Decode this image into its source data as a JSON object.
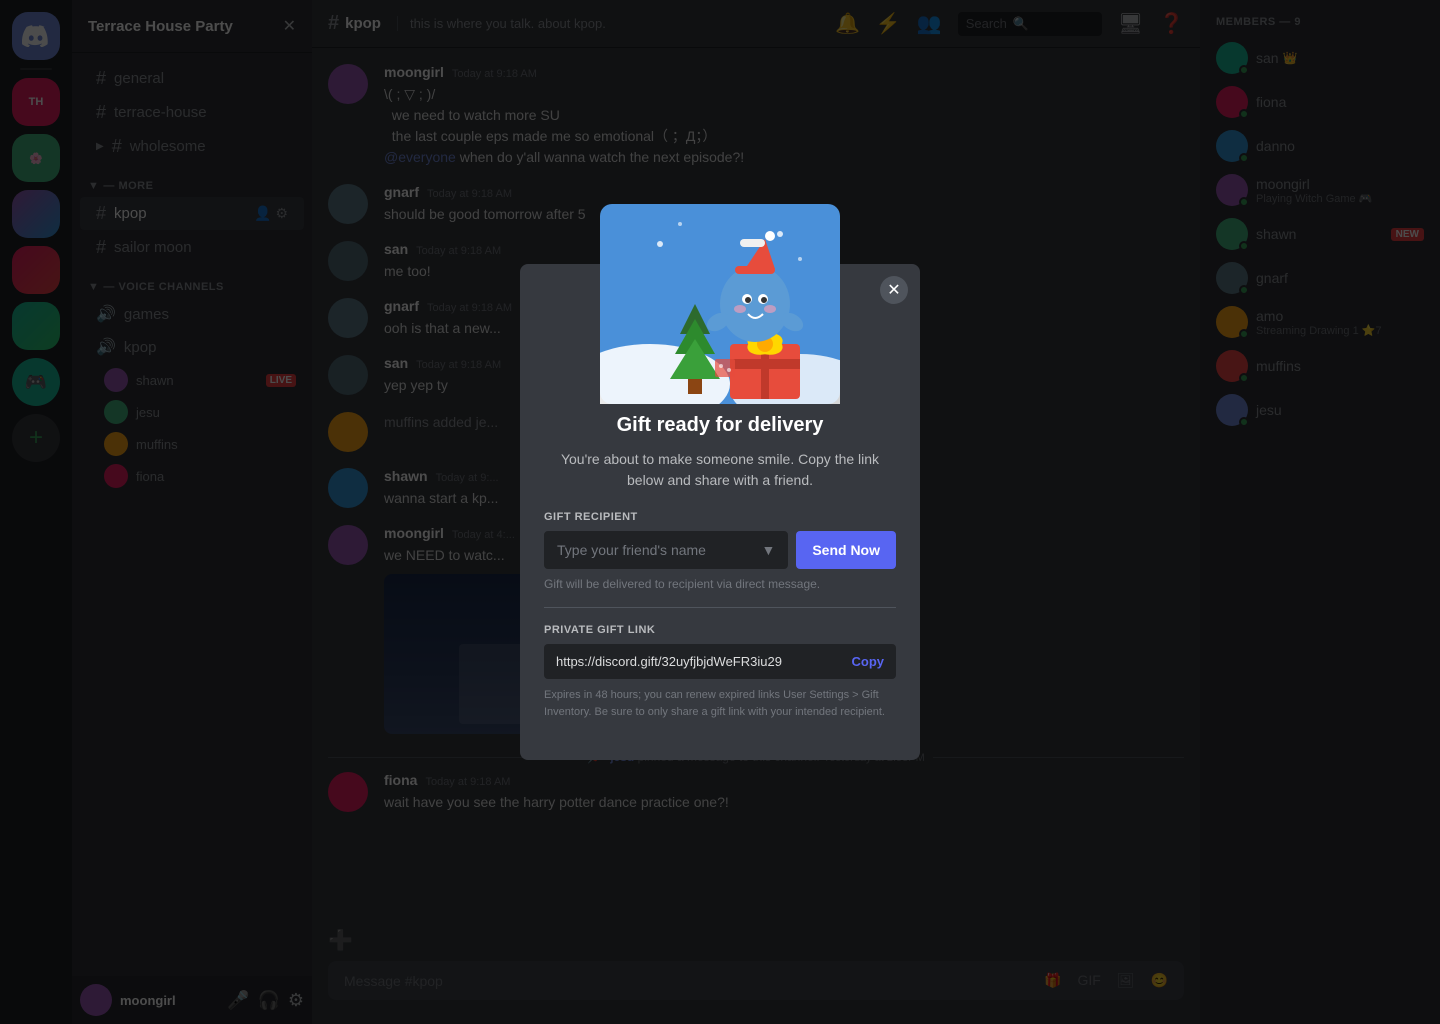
{
  "app": {
    "title": "Discord"
  },
  "server": {
    "name": "Terrace House Party",
    "dropdown_icon": "▼"
  },
  "channels": {
    "text_header": "— MORE",
    "text_channels": [
      {
        "name": "general",
        "type": "text"
      },
      {
        "name": "terrace-house",
        "type": "text"
      },
      {
        "name": "wholesome",
        "type": "text",
        "has_arrow": true
      }
    ],
    "more_channels": [
      {
        "name": "kpop",
        "type": "text",
        "active": true,
        "icons": true
      },
      {
        "name": "sailor moon",
        "type": "text"
      }
    ],
    "voice_header": "— VOICE CHANNELS",
    "voice_channels": [
      {
        "name": "games",
        "type": "voice"
      },
      {
        "name": "kpop",
        "type": "voice",
        "users": [
          {
            "name": "shawn",
            "live": true
          },
          {
            "name": "jesu",
            "live": false
          },
          {
            "name": "muffins",
            "live": false
          },
          {
            "name": "fiona",
            "live": false
          }
        ]
      }
    ]
  },
  "current_channel": {
    "name": "kpop",
    "description": "this is where you talk. about kpop."
  },
  "user_panel": {
    "name": "moongirl",
    "mic_icon": "🎤",
    "headphone_icon": "🎧",
    "settings_icon": "⚙"
  },
  "header": {
    "search_placeholder": "Search",
    "icons": [
      "🔔",
      "⚡",
      "👥",
      "🖥",
      "❓"
    ]
  },
  "messages": [
    {
      "id": 1,
      "author": "moongirl",
      "time": "Today at 9:18 AM",
      "lines": [
        "\\(;▽;)/",
        "we need to watch more SU",
        "the last couple eps made me so emotional（ ；Д；）",
        "@everyone when do y'all wanna watch the next episode?!"
      ],
      "has_mention": true
    },
    {
      "id": 2,
      "author": "gnarf",
      "time": "Today at 9:18 AM",
      "lines": [
        "should be good tomorrow after 5"
      ]
    },
    {
      "id": 3,
      "author": "san",
      "time": "Today at 9:18 AM",
      "lines": [
        "me too!"
      ]
    },
    {
      "id": 4,
      "author": "gnarf",
      "time": "Today at 9:18 AM",
      "lines": [
        "ooh is that a new..."
      ]
    },
    {
      "id": 5,
      "author": "san",
      "time": "Today at 9:18 AM",
      "lines": [
        "yep yep ty"
      ]
    },
    {
      "id": 6,
      "author": "muffins",
      "time": "",
      "lines": [
        "muffins added je..."
      ],
      "is_system": false
    },
    {
      "id": 7,
      "author": "shawn",
      "time": "Today at 9:...",
      "lines": [
        "wanna start a kp..."
      ]
    },
    {
      "id": 8,
      "author": "moongirl",
      "time": "Today at 4:...",
      "lines": [
        "we NEED to watc..."
      ],
      "has_image": true
    }
  ],
  "system_messages": [
    {
      "text": "jesu pinned a message to this channel.",
      "time": "Yesterday at 2:58PM"
    }
  ],
  "bottom_message": {
    "author": "fiona",
    "time": "Today at 9:18 AM",
    "text": "wait have you see the harry potter dance practice one?!"
  },
  "members": {
    "header": "MEMBERS — 9",
    "list": [
      {
        "name": "san",
        "crown": true,
        "online": true
      },
      {
        "name": "fiona",
        "online": true
      },
      {
        "name": "danno",
        "online": true
      },
      {
        "name": "moongirl",
        "online": true,
        "status": "Playing Witch Game 🎮"
      },
      {
        "name": "shawn",
        "online": true,
        "badge": "NEW"
      },
      {
        "name": "gnarf",
        "online": true
      },
      {
        "name": "amo",
        "online": true,
        "status": "Streaming Drawing 1 ⭐7"
      },
      {
        "name": "muffins",
        "online": true
      },
      {
        "name": "jesu",
        "online": true
      }
    ]
  },
  "modal": {
    "title": "Gift ready for delivery",
    "description": "You're about to make someone smile. Copy the link below and share with a friend.",
    "gift_recipient_label": "GIFT RECIPIENT",
    "recipient_placeholder": "Type your friend's name",
    "send_button_label": "Send Now",
    "hint": "Gift will be delivered to recipient via direct message.",
    "private_link_label": "PRIVATE GIFT LINK",
    "link_value": "https://discord.gift/32uyfjbjdWeFR3iu29",
    "copy_label": "Copy",
    "expiry_text": "Expires in 48 hours; you can renew expired links User Settings > Gift Inventory. Be sure to only share a gift link with your intended recipient."
  }
}
